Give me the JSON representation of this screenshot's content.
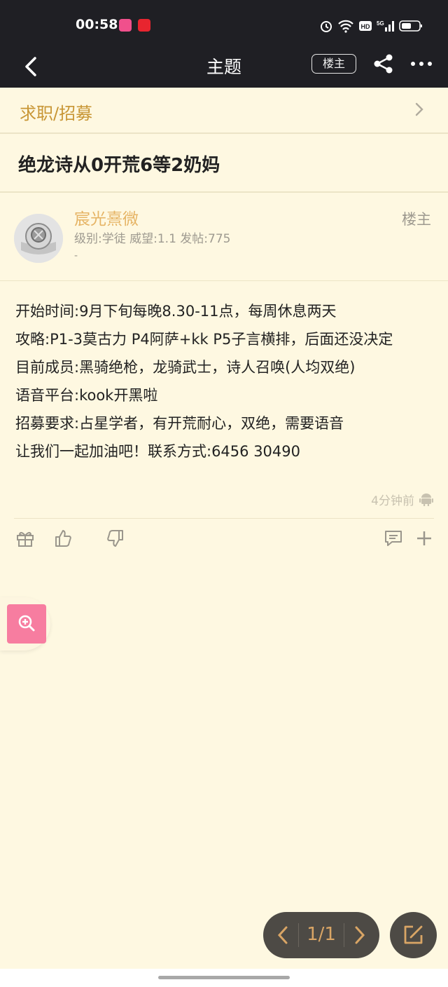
{
  "status_bar": {
    "time": "00:58",
    "app_badges": [
      "lofter-app-icon",
      "news-app-icon"
    ],
    "icons": [
      "alarm-icon",
      "wifi-icon",
      "hd-icon",
      "signal-5g-icon",
      "battery-icon"
    ]
  },
  "nav": {
    "title": "主题",
    "op_filter_label": "楼主"
  },
  "board": {
    "label": "求职/招募"
  },
  "thread": {
    "title": "绝龙诗从0开荒6等2奶妈"
  },
  "author": {
    "name": "宸光熹微",
    "stats": "级别:学徒 威望:1.1 发帖:775",
    "signature": "-",
    "op_tag": "楼主"
  },
  "post": {
    "lines": [
      "开始时间:9月下旬每晚8.30-11点，每周休息两天",
      "攻略:P1-3莫古力 P4阿萨+kk P5子言横排，后面还没决定",
      "目前成员:黑骑绝枪，龙骑武士，诗人召唤(人均双绝)",
      "语音平台:kook开黑啦",
      "招募要求:占星学者，有开荒耐心，双绝，需要语音",
      "让我们一起加油吧！联系方式:6456 30490"
    ],
    "time_ago": "4分钟前"
  },
  "pager": {
    "page_label": "1/1"
  },
  "colors": {
    "background": "#fef8e1",
    "header": "#1f1f24",
    "accent": "#c89635",
    "author_name": "#e6b465",
    "zoom_fab": "#f77da0",
    "pager_bg": "#4d4a45"
  }
}
